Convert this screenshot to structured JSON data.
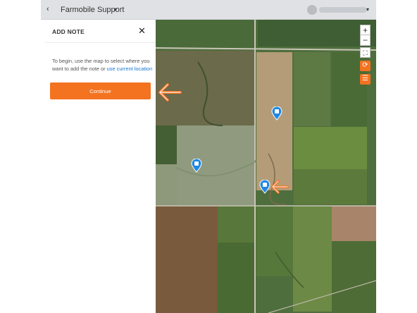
{
  "header": {
    "back_icon": "chevron-left-icon",
    "back_glyph": "‹",
    "title": "Farmobile Support",
    "title_caret": "▾",
    "user_caret": "▾"
  },
  "panel": {
    "title": "ADD NOTE",
    "close_glyph": "✕",
    "instructions_text": "To begin, use the map to select where you want to add the note or ",
    "instructions_link": "use current location",
    "continue_label": "Continue"
  },
  "map_controls": {
    "zoom_in": "+",
    "zoom_out": "−",
    "fit": "⛶",
    "sync": "⟳",
    "layers": "☰"
  },
  "note_pins": [
    "note-pin",
    "note-pin",
    "note-pin"
  ],
  "colors": {
    "accent": "#f37321",
    "link": "#1976d2",
    "pin": "#1e88e5",
    "topbar": "#dfe1e4"
  }
}
